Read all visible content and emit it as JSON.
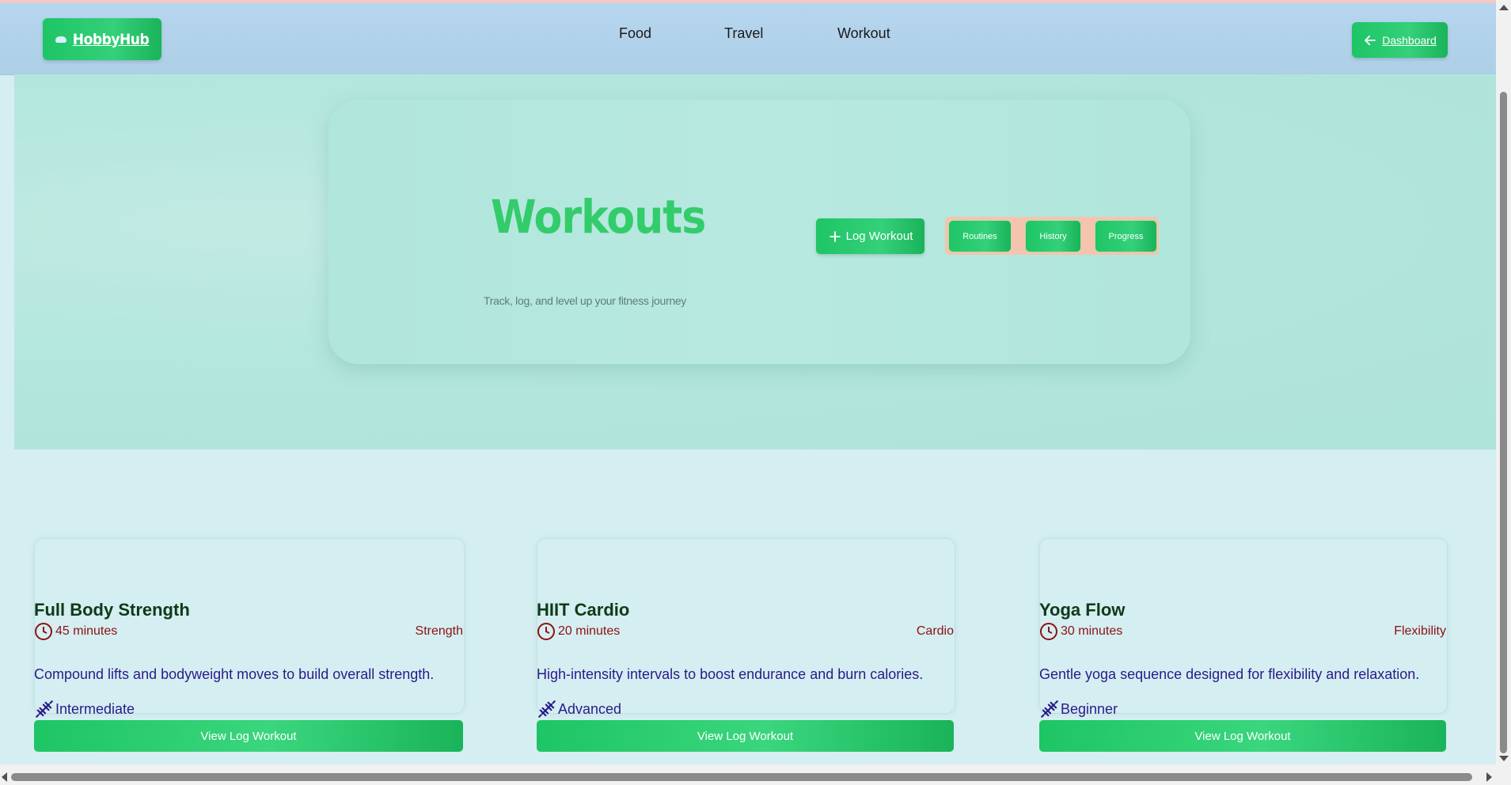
{
  "header": {
    "logo_label": "HobbyHub",
    "nav": [
      "Food",
      "Travel",
      "Workout"
    ],
    "dashboard_label": "Dashboard"
  },
  "hero": {
    "title": "Workouts",
    "subtitle": "Track, log, and level up your fitness journey",
    "log_button": "Log Workout",
    "tabs": [
      "Routines",
      "History",
      "Progress"
    ]
  },
  "cards": [
    {
      "title": "Full Body Strength",
      "duration": "45 minutes",
      "category": "Strength",
      "description": "Compound lifts and bodyweight moves to build overall strength.",
      "level": "Intermediate",
      "button": "View Log Workout"
    },
    {
      "title": "HIIT Cardio",
      "duration": "20 minutes",
      "category": "Cardio",
      "description": "High-intensity intervals to boost endurance and burn calories.",
      "level": "Advanced",
      "button": "View Log Workout"
    },
    {
      "title": "Yoga Flow",
      "duration": "30 minutes",
      "category": "Flexibility",
      "description": "Gentle yoga sequence designed for flexibility and relaxation.",
      "level": "Beginner",
      "button": "View Log Workout"
    }
  ],
  "colors": {
    "accent_green": "#1ec565",
    "header_blue": "#b7d5ef",
    "hero_bg": "#b4e7de",
    "page_bg": "#d5eef1",
    "meta_red": "#8b1212",
    "text_indigo": "#2a1a8a",
    "tab_bar_bg": "#f4c4b0"
  },
  "icons": [
    "cloud-icon",
    "arrow-left-icon",
    "plus-icon",
    "clock-icon",
    "dumbbell-icon"
  ]
}
